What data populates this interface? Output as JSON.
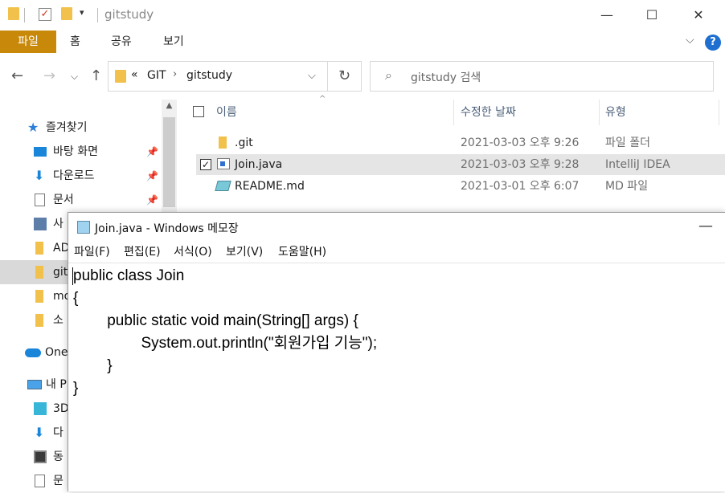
{
  "explorer": {
    "title": "gitstudy",
    "ribbon_tabs": [
      "파일",
      "홈",
      "공유",
      "보기"
    ],
    "help_label": "?",
    "nav": {
      "breadcrumb_prefix": "«",
      "breadcrumb": [
        "GIT",
        "gitstudy"
      ],
      "search_placeholder": "gitstudy 검색"
    },
    "navpane": [
      {
        "label": "즐겨찾기",
        "icon": "star-icon"
      },
      {
        "label": "바탕 화면",
        "icon": "desktop-icon",
        "pinned": true
      },
      {
        "label": "다운로드",
        "icon": "download-icon",
        "pinned": true
      },
      {
        "label": "문서",
        "icon": "document-icon",
        "pinned": true
      },
      {
        "label": "사",
        "icon": "picture-icon"
      },
      {
        "label": "AD",
        "icon": "folder-icon"
      },
      {
        "label": "git",
        "icon": "folder-icon",
        "selected": true
      },
      {
        "label": "mo",
        "icon": "folder-icon"
      },
      {
        "label": "소",
        "icon": "folder-icon"
      },
      {
        "label": "One",
        "icon": "cloud-icon"
      },
      {
        "label": "내 P",
        "icon": "computer-icon"
      },
      {
        "label": "3D",
        "icon": "cube-icon"
      },
      {
        "label": "다",
        "icon": "download-icon"
      },
      {
        "label": "동",
        "icon": "video-icon"
      },
      {
        "label": "문",
        "icon": "document-icon"
      }
    ],
    "columns": {
      "name": "이름",
      "modified": "수정한 날짜",
      "type": "유형"
    },
    "files": [
      {
        "name": ".git",
        "modified": "2021-03-03 오후 9:26",
        "type": "파일 폴더",
        "icon": "folder-icon",
        "selected": false
      },
      {
        "name": "Join.java",
        "modified": "2021-03-03 오후 9:28",
        "type": "IntelliJ IDEA",
        "icon": "java-file-icon",
        "selected": true
      },
      {
        "name": "README.md",
        "modified": "2021-03-01 오후 6:07",
        "type": "MD 파일",
        "icon": "md-file-icon",
        "selected": false
      }
    ]
  },
  "notepad": {
    "title": "Join.java - Windows 메모장",
    "menu": [
      "파일(F)",
      "편집(E)",
      "서식(O)",
      "보기(V)",
      "도움말(H)"
    ],
    "content": "public class Join\n{\n\tpublic static void main(String[] args) {\n\t\tSystem.out.println(\"회원가입 기능\");\n\t}\n}"
  },
  "colors": {
    "ribbon_file_tab": "#c8890a",
    "selection": "#e5e5e5",
    "help": "#1e6fd0"
  }
}
